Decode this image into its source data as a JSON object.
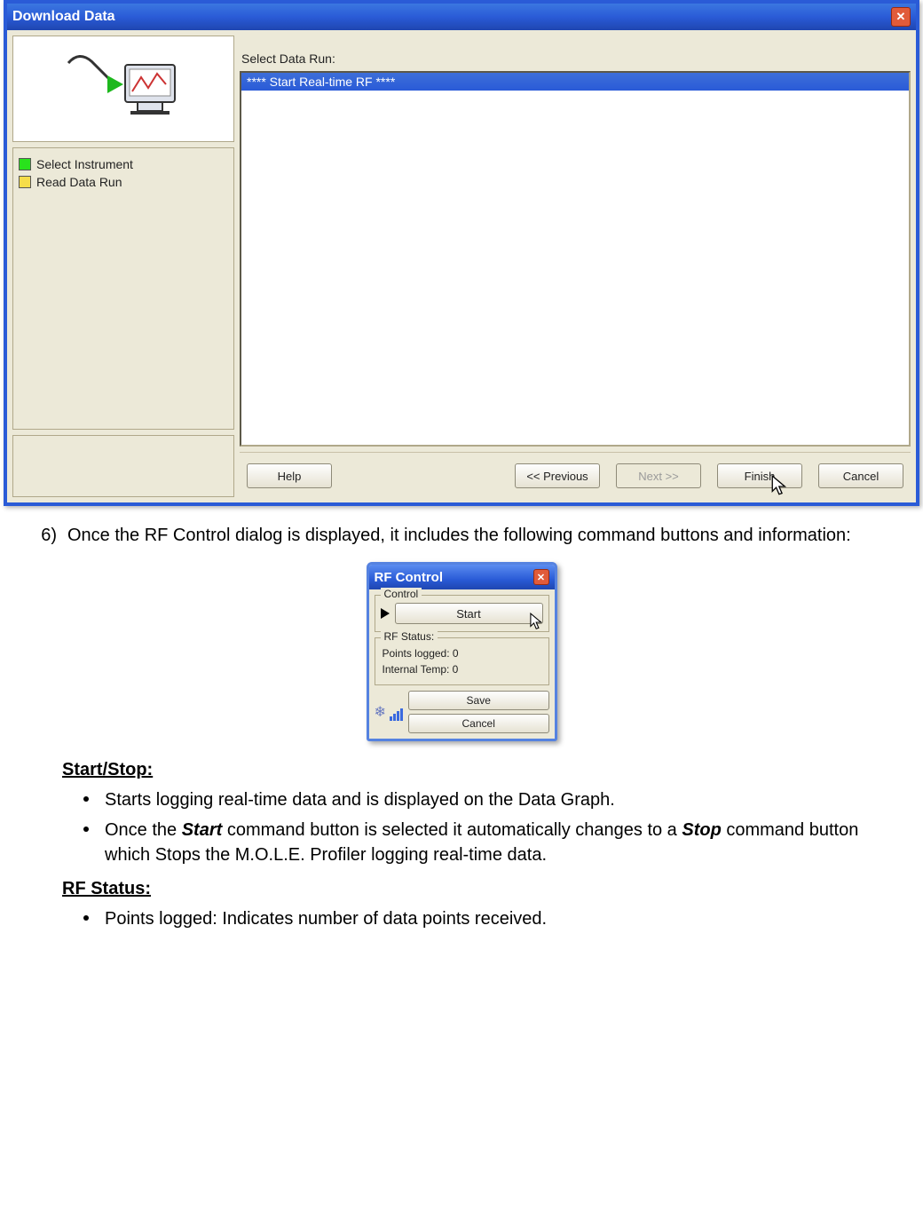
{
  "download_window": {
    "title": "Download Data",
    "steps": [
      {
        "label": "Select Instrument",
        "color": "#29e21c"
      },
      {
        "label": "Read Data Run",
        "color": "#f6dd4a"
      }
    ],
    "select_label": "Select Data Run:",
    "list_item": "**** Start Real-time RF ****",
    "buttons": {
      "help": "Help",
      "previous": "<< Previous",
      "next": "Next >>",
      "finish": "Finish",
      "cancel": "Cancel"
    }
  },
  "step6": {
    "num": "6)",
    "text": "Once the RF Control dialog is displayed, it includes the following command buttons and information:"
  },
  "rf_control": {
    "title": "RF Control",
    "group_control": "Control",
    "start": "Start",
    "group_status": "RF Status:",
    "points_logged_label": "Points logged:",
    "points_logged_value": "0",
    "internal_temp_label": "Internal Temp:",
    "internal_temp_value": "0",
    "save": "Save",
    "cancel": "Cancel"
  },
  "definitions": {
    "startstop_head": "Start/Stop:",
    "b1": "Starts logging real-time data and is displayed on the Data Graph.",
    "b2_pre": "Once the ",
    "b2_start": "Start",
    "b2_mid": " command button is selected it automatically changes to a ",
    "b2_stop": "Stop",
    "b2_post": " command button which Stops the M.O.L.E. Profiler logging real-time data.",
    "rfstatus_head": "RF Status:",
    "b3": "Points logged: Indicates number of data points received."
  }
}
